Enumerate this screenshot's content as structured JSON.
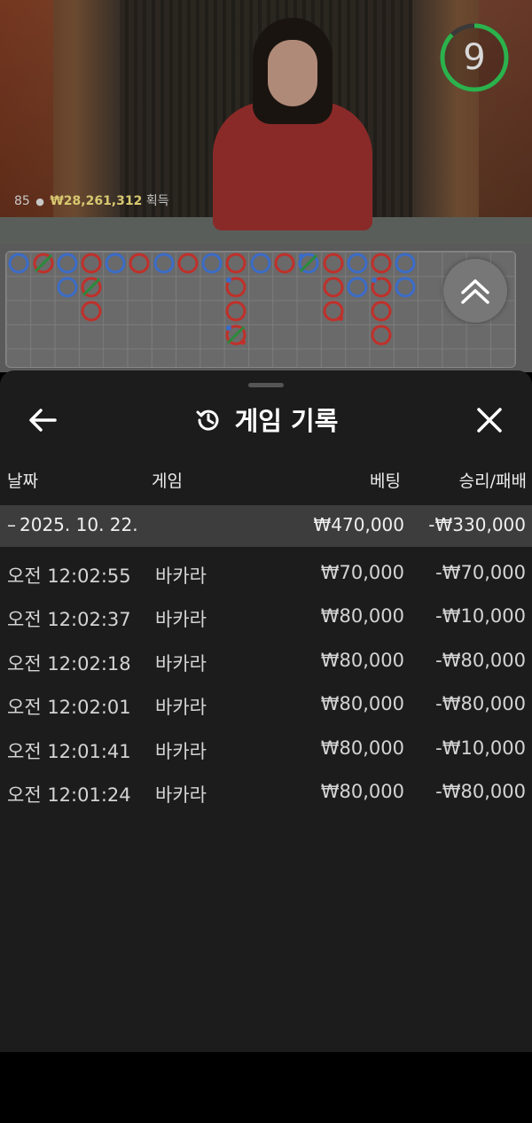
{
  "stream": {
    "viewer_count": "85",
    "winnings": "₩28,261,312",
    "winnings_label": "획득",
    "timer": "9"
  },
  "history": {
    "title": "게임 기록",
    "columns": {
      "date": "날짜",
      "game": "게임",
      "bet": "베팅",
      "win_loss": "승리/패배"
    },
    "date_group": {
      "date": "2025. 10. 22.",
      "bet_total": "₩470,000",
      "result_total": "-₩330,000"
    },
    "rows": [
      {
        "time": "오전 12:02:55",
        "game": "바카라",
        "bet": "₩70,000",
        "result": "-₩70,000"
      },
      {
        "time": "오전 12:02:37",
        "game": "바카라",
        "bet": "₩80,000",
        "result": "-₩10,000"
      },
      {
        "time": "오전 12:02:18",
        "game": "바카라",
        "bet": "₩80,000",
        "result": "-₩80,000"
      },
      {
        "time": "오전 12:02:01",
        "game": "바카라",
        "bet": "₩80,000",
        "result": "-₩80,000"
      },
      {
        "time": "오전 12:01:41",
        "game": "바카라",
        "bet": "₩80,000",
        "result": "-₩10,000"
      },
      {
        "time": "오전 12:01:24",
        "game": "바카라",
        "bet": "₩80,000",
        "result": "-₩80,000"
      }
    ]
  },
  "colors": {
    "player_blue": "#3b6cc8",
    "banker_red": "#c0302a",
    "tie_green": "#2a8a3a",
    "timer_green": "#2bb24c"
  },
  "icons": {
    "back": "arrow-left-icon",
    "history": "history-clock-icon",
    "close": "close-x-icon",
    "expand": "double-chevron-up-icon"
  }
}
